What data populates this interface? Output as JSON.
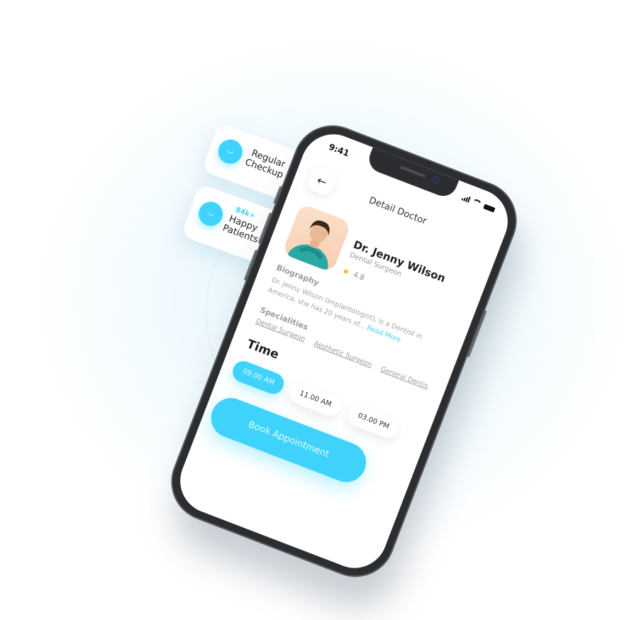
{
  "floating_cards": {
    "checkup": {
      "line1": "Regular",
      "line2": "Checkup"
    },
    "patients": {
      "count": "84k+",
      "line1": "Happy",
      "line2": "Patients"
    }
  },
  "status_bar": {
    "time": "9:41"
  },
  "header": {
    "title": "Detail Doctor"
  },
  "doctor": {
    "name": "Dr. Jenny Wilson",
    "role": "Dental Surgeon",
    "rating": "4.8"
  },
  "biography": {
    "title": "Biography",
    "text": "Dr. Jenny Wilson (Implantologist), is a Dentist in America, she has 20 years of...",
    "read_more": "Read More"
  },
  "specialities": {
    "title": "Specialities",
    "items": [
      "Dental Surgeon",
      "Aesthetic Surgeon",
      "General Dentis"
    ]
  },
  "time": {
    "title": "Time",
    "slots": [
      "09.00 AM",
      "11.00 AM",
      "03.00 PM"
    ]
  },
  "book_button": "Book Appointment",
  "colors": {
    "accent": "#3fd3fb",
    "phone_frame": "#2b2d30"
  }
}
